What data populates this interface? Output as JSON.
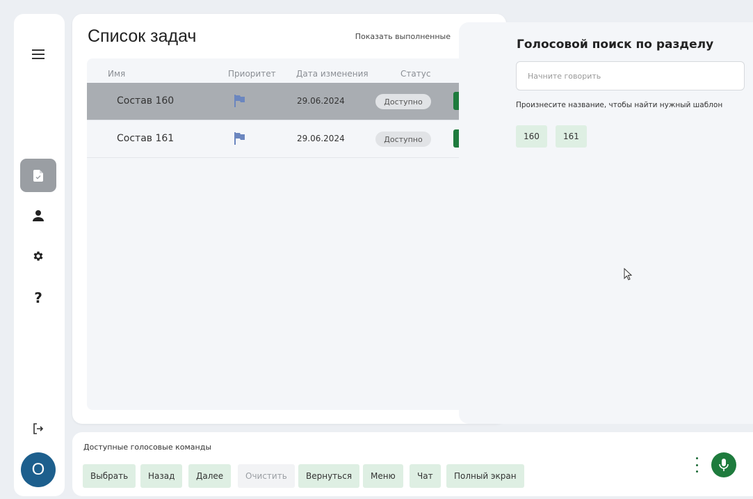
{
  "sidebar": {
    "avatar_initial": "O"
  },
  "tasks": {
    "title": "Список задач",
    "toggle_label": "Показать выполненные",
    "toggle_on": false,
    "columns": {
      "name": "Имя",
      "priority": "Приоритет",
      "date": "Дата изменения",
      "status": "Статус"
    },
    "rows": [
      {
        "name": "Состав 160",
        "date": "29.06.2024",
        "status": "Доступно",
        "selected": true
      },
      {
        "name": "Состав 161",
        "date": "29.06.2024",
        "status": "Доступно",
        "selected": false
      }
    ],
    "go_label": ">"
  },
  "voice_search": {
    "title": "Голосовой поиск по разделу",
    "placeholder": "Начните говорить",
    "hint": "Произнесите название, чтобы найти нужный шаблон",
    "chips": [
      "160",
      "161"
    ]
  },
  "commands": {
    "label": "Доступные голосовые команды",
    "buttons": {
      "select": "Выбрать",
      "back": "Назад",
      "next": "Далее",
      "clear": "Очистить",
      "return": "Вернуться",
      "menu": "Меню",
      "chat": "Чат",
      "fullscreen": "Полный экран"
    }
  },
  "colors": {
    "accent_green": "#1e7b3d",
    "chip_bg": "#deefe3",
    "avatar_bg": "#1d5f8d",
    "flag": "#6b86bf",
    "selected_row": "#a9adb2"
  },
  "icons": {
    "menu": "hamburger-icon",
    "tasks": "document-check-icon",
    "profile": "user-icon",
    "settings": "gear-icon",
    "help": "question-icon",
    "logout": "logout-icon",
    "priority": "flag-icon",
    "mic": "microphone-icon"
  }
}
